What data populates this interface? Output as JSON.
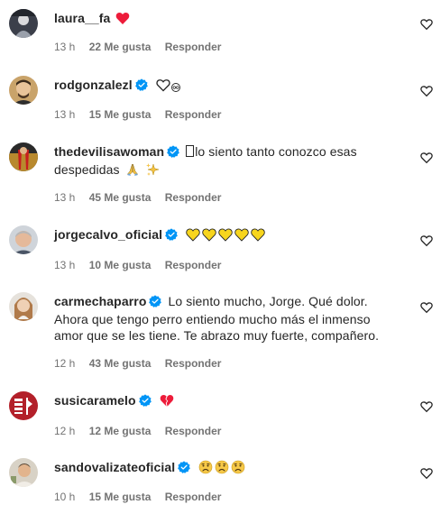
{
  "colors": {
    "text": "#262626",
    "secondary": "#737373",
    "verified": "#0095f6",
    "heart_red": "#ed1c3a",
    "emoji_yellow": "#f7d51d"
  },
  "comments": [
    {
      "username": "laura__fa",
      "verified": false,
      "text": "",
      "emojis": [
        "red-heart"
      ],
      "time": "13 h",
      "likes": "22 Me gusta",
      "reply": "Responder"
    },
    {
      "username": "rodgonzalezl",
      "verified": true,
      "text": "",
      "emojis": [
        "white-heart",
        "infinity"
      ],
      "time": "13 h",
      "likes": "15 Me gusta",
      "reply": "Responder"
    },
    {
      "username": "thedevilisawoman",
      "verified": true,
      "text": "lo siento tanto conozco esas despedidas",
      "emojis": [
        "folded-hands",
        "sparkles"
      ],
      "time": "13 h",
      "likes": "45 Me gusta",
      "reply": "Responder"
    },
    {
      "username": "jorgecalvo_oficial",
      "verified": true,
      "text": "",
      "emojis": [
        "yellow-heart",
        "yellow-heart",
        "yellow-heart",
        "yellow-heart",
        "yellow-heart"
      ],
      "time": "13 h",
      "likes": "10 Me gusta",
      "reply": "Responder"
    },
    {
      "username": "carmechaparro",
      "verified": true,
      "text": "Lo siento mucho, Jorge. Qué dolor. Ahora que tengo perro entiendo mucho más el inmenso amor que se les tiene. Te abrazo muy fuerte, compañero.",
      "emojis": [],
      "time": "12 h",
      "likes": "43 Me gusta",
      "reply": "Responder"
    },
    {
      "username": "susicaramelo",
      "verified": true,
      "text": "",
      "emojis": [
        "broken-heart"
      ],
      "time": "12 h",
      "likes": "12 Me gusta",
      "reply": "Responder"
    },
    {
      "username": "sandovalizateoficial",
      "verified": true,
      "text": "",
      "emojis": [
        "sad-face",
        "sad-face",
        "sad-face"
      ],
      "time": "10 h",
      "likes": "15 Me gusta",
      "reply": "Responder"
    }
  ]
}
